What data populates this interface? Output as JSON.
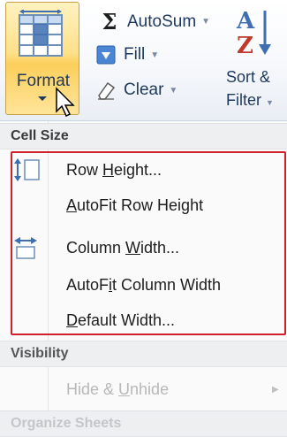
{
  "ribbon": {
    "format": {
      "label": "Format",
      "icon": "format-table-icon"
    },
    "autosum": {
      "label": "AutoSum",
      "icon": "sigma-icon",
      "dropdown": "▼"
    },
    "fill": {
      "label": "Fill",
      "icon": "fill-down-icon",
      "dropdown": "▼"
    },
    "clear": {
      "label": "Clear",
      "icon": "eraser-icon",
      "dropdown": "▼"
    },
    "sort": {
      "line1": "Sort &",
      "line2": "Filter",
      "icon": "sort-az-icon",
      "dropdown": "▼"
    }
  },
  "menu": {
    "cell_size_header": "Cell Size",
    "row_height": {
      "before": "Row ",
      "accel": "H",
      "after": "eight..."
    },
    "autofit_row": {
      "before": "",
      "accel": "A",
      "after": "utoFit Row Height"
    },
    "column_width": {
      "before": "Column ",
      "accel": "W",
      "after": "idth..."
    },
    "autofit_col": {
      "before": "AutoF",
      "accel": "i",
      "after": "t Column Width"
    },
    "default_width": {
      "before": "",
      "accel": "D",
      "after": "efault Width..."
    },
    "visibility_header": "Visibility",
    "hide_unhide": {
      "before": "Hide & ",
      "accel": "U",
      "after": "nhide",
      "submenu_arrow": "▶"
    },
    "organize_header": "Organize Sheets"
  },
  "colors": {
    "highlight": "#d0202a",
    "format_active": "#ffe08a",
    "ribbon_text": "#1e395b"
  }
}
